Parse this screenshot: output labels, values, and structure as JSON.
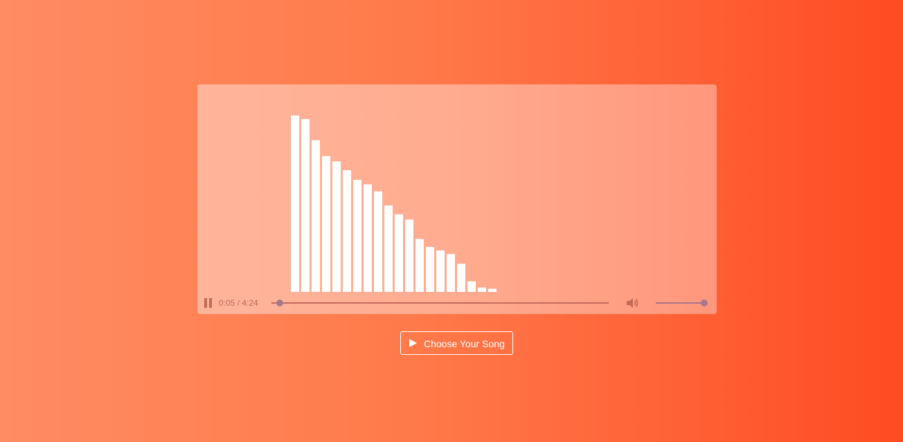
{
  "player": {
    "current_time": "0:05",
    "duration": "4:24",
    "time_display": "0:05 / 4:24",
    "progress_fraction": 0.017,
    "volume_fraction": 1.0,
    "state": "playing",
    "pause_icon": "pause-icon",
    "volume_icon": "speaker-volume-icon"
  },
  "visualizer": {
    "levels": [
      1.0,
      0.98,
      0.86,
      0.77,
      0.74,
      0.69,
      0.635,
      0.61,
      0.57,
      0.49,
      0.44,
      0.41,
      0.3,
      0.255,
      0.235,
      0.215,
      0.16,
      0.06,
      0.025,
      0.018
    ],
    "bar_color": "#ffffff"
  },
  "chooser": {
    "label": "Choose Your Song",
    "icon": "play-icon"
  },
  "colors": {
    "background_start": "#ff8c62",
    "background_end": "#ff4b21",
    "accent": "#a57a8e"
  }
}
